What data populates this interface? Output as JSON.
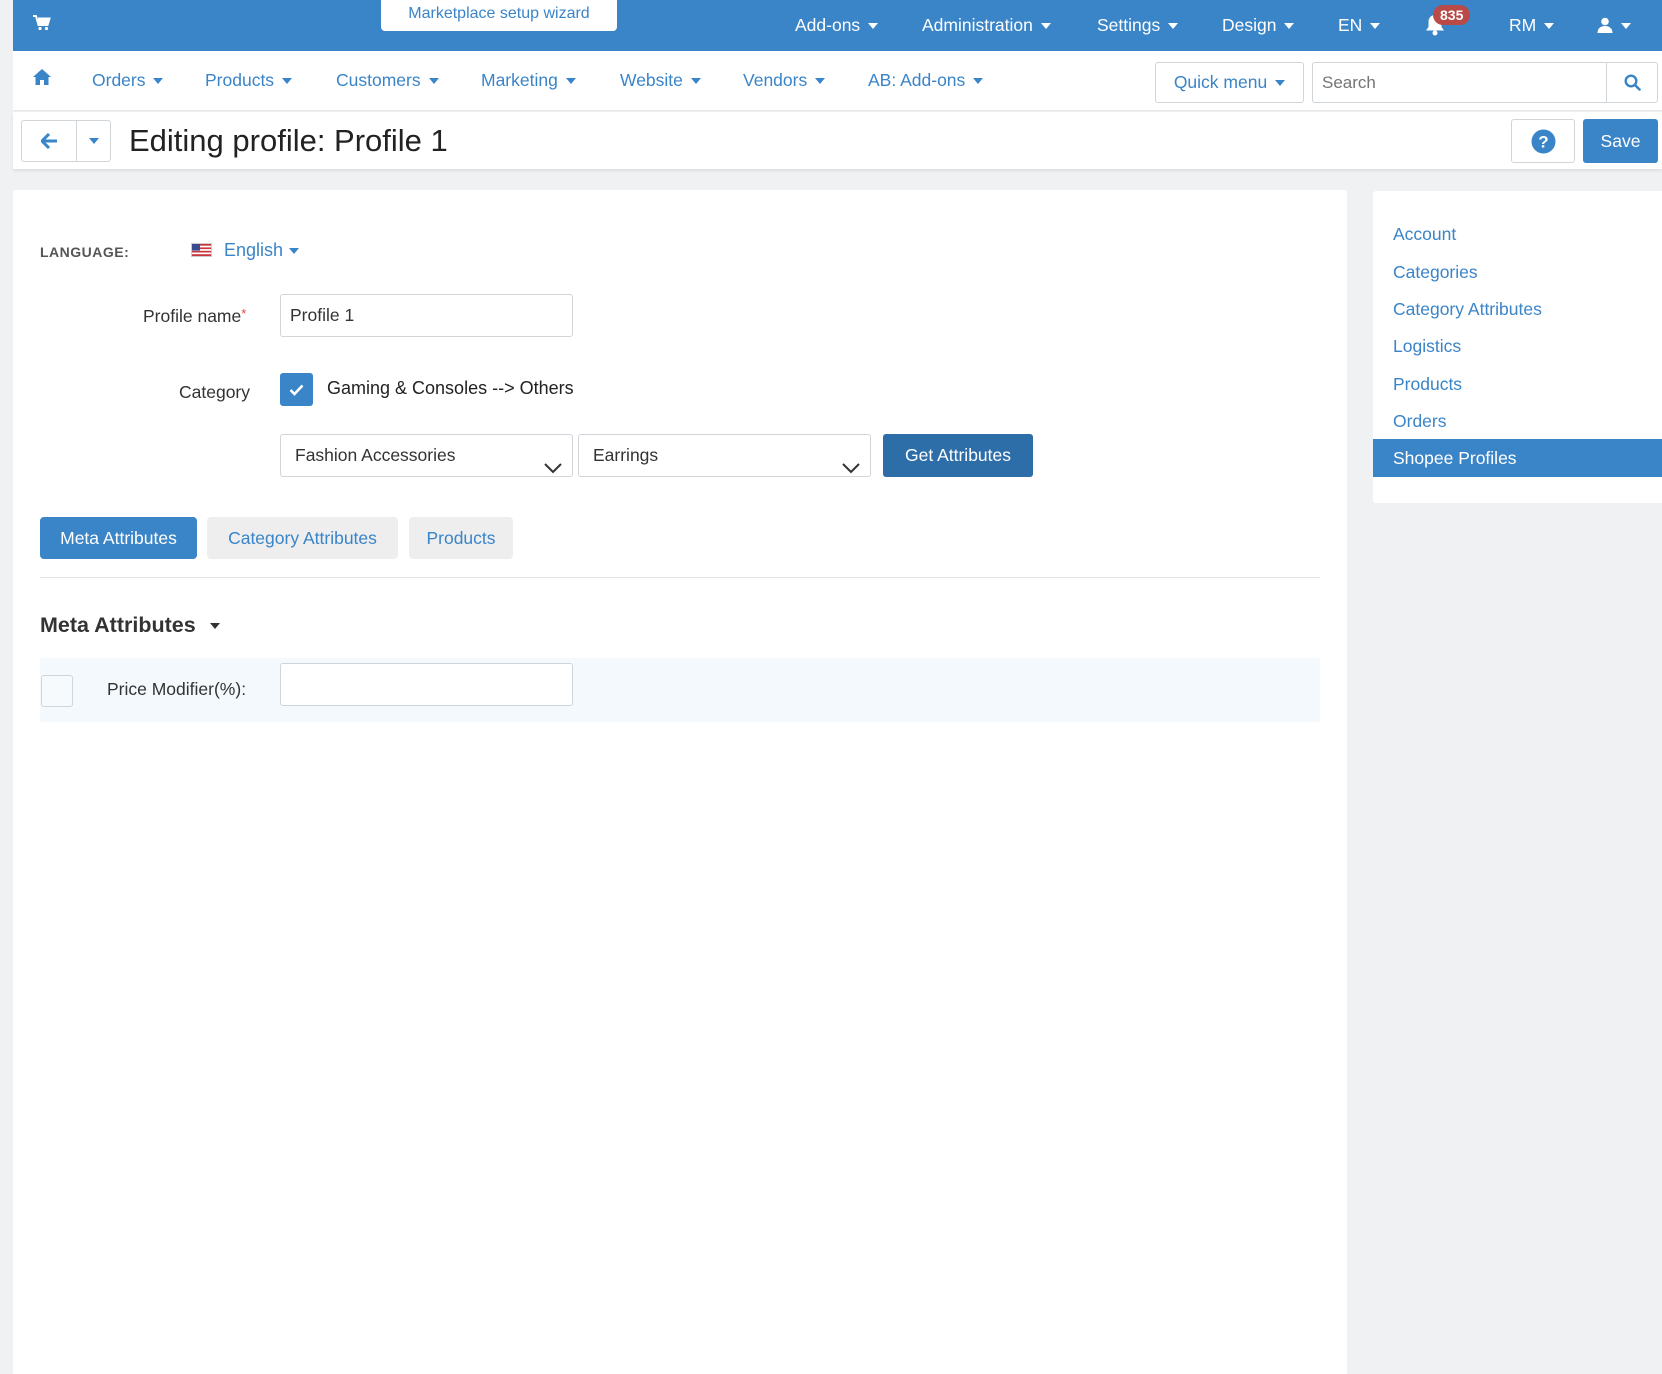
{
  "topbar": {
    "wizard_label": "Marketplace setup wizard",
    "menus": [
      "Add-ons",
      "Administration",
      "Settings",
      "Design",
      "EN"
    ],
    "notification_count": "835",
    "user_initials": "RM"
  },
  "nav": {
    "items": [
      "Orders",
      "Products",
      "Customers",
      "Marketing",
      "Website",
      "Vendors",
      "AB: Add-ons"
    ],
    "quick_menu": "Quick menu",
    "search_placeholder": "Search"
  },
  "titlebar": {
    "title": "Editing profile: Profile 1",
    "save_label": "Save"
  },
  "form": {
    "language_label": "LANGUAGE:",
    "language_value": "English",
    "profile_name_label": "Profile name",
    "required_mark": "*",
    "profile_name_value": "Profile 1",
    "category_label": "Category",
    "category_checked": true,
    "category_path": "Gaming & Consoles --> Others",
    "select_1": "Fashion Accessories",
    "select_2": "Earrings",
    "get_attributes_label": "Get Attributes"
  },
  "tabs": [
    {
      "label": "Meta Attributes",
      "active": true
    },
    {
      "label": "Category Attributes",
      "active": false
    },
    {
      "label": "Products",
      "active": false
    }
  ],
  "meta": {
    "section_title": "Meta Attributes",
    "price_modifier_label": "Price Modifier(%):",
    "price_modifier_value": ""
  },
  "sidebar": {
    "items": [
      "Account",
      "Categories",
      "Category Attributes",
      "Logistics",
      "Products",
      "Orders",
      "Shopee Profiles"
    ],
    "active_index": 6
  },
  "colors": {
    "brand": "#3a84c8",
    "badge": "#b94a48",
    "get_attributes": "#2d6ea8"
  }
}
